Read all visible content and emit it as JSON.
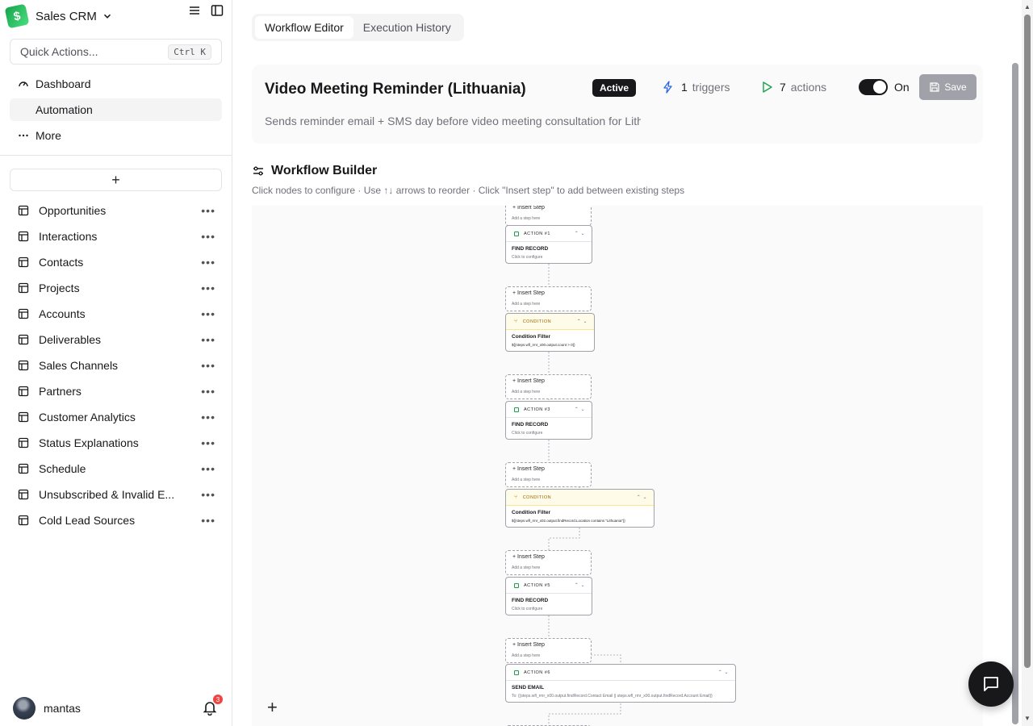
{
  "app": {
    "name": "Sales CRM"
  },
  "quick_actions": {
    "placeholder": "Quick Actions...",
    "shortcut": "Ctrl K"
  },
  "nav": [
    {
      "label": "Dashboard",
      "icon": "gauge-icon"
    },
    {
      "label": "Automation",
      "icon": "none",
      "active": true
    },
    {
      "label": "More",
      "icon": "ellipsis-icon"
    }
  ],
  "tables": [
    {
      "label": "Opportunities"
    },
    {
      "label": "Interactions"
    },
    {
      "label": "Contacts"
    },
    {
      "label": "Projects"
    },
    {
      "label": "Accounts"
    },
    {
      "label": "Deliverables"
    },
    {
      "label": "Sales Channels"
    },
    {
      "label": "Partners"
    },
    {
      "label": "Customer Analytics"
    },
    {
      "label": "Status Explanations"
    },
    {
      "label": "Schedule"
    },
    {
      "label": "Unsubscribed & Invalid E..."
    },
    {
      "label": "Cold Lead Sources"
    }
  ],
  "user": {
    "name": "mantas",
    "notifications": "3"
  },
  "tabs": [
    {
      "label": "Workflow Editor",
      "active": true
    },
    {
      "label": "Execution History"
    }
  ],
  "workflow": {
    "title": "Video Meeting Reminder (Lithuania)",
    "status": "Active",
    "triggers_count": "1",
    "triggers_label": "triggers",
    "actions_count": "7",
    "actions_label": "actions",
    "toggle_label": "On",
    "save_label": "Save",
    "description": "Sends reminder email + SMS day before video meeting consultation for Lithuania"
  },
  "builder": {
    "title": "Workflow Builder",
    "help": "Click nodes to configure · Use ↑↓ arrows to reorder · Click \"Insert step\" to add between existing steps",
    "insert_label": "Insert Step",
    "insert_sub": "Add a step here",
    "nodes": [
      {
        "kind": "action",
        "header": "ACTION #1",
        "name": "FIND RECORD",
        "sub": "Click to configure"
      },
      {
        "kind": "condition",
        "header": "CONDITION",
        "name": "Condition Filter",
        "sub": "${{steps.wfl_rmr_x00.output.count > 0}}"
      },
      {
        "kind": "action",
        "header": "ACTION #3",
        "name": "FIND RECORD",
        "sub": "Click to configure"
      },
      {
        "kind": "condition",
        "header": "CONDITION",
        "name": "Condition Filter",
        "sub": "${{steps.wfl_rmr_x02.output.findRecord.Location contains \"Lithuania\"}}"
      },
      {
        "kind": "action",
        "header": "ACTION #5",
        "name": "FIND RECORD",
        "sub": "Click to configure"
      },
      {
        "kind": "action",
        "header": "ACTION #6",
        "name": "SEND EMAIL",
        "sub": "To: {{steps.wfl_rmr_x00.output.findRecord.Contact Email || steps.wfl_rmr_x00.output.findRecord.Account Email}}"
      }
    ]
  }
}
